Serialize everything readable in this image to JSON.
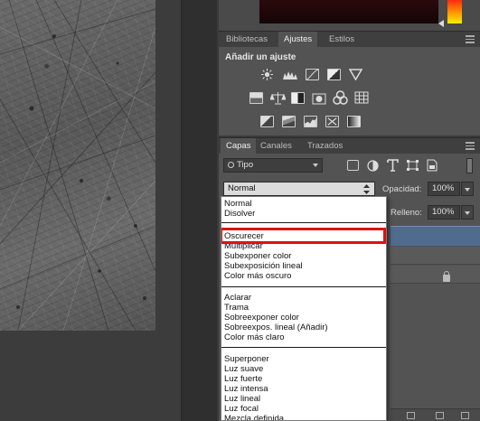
{
  "panels": {
    "adjust_tabs": [
      {
        "label": "Bibliotecas"
      },
      {
        "label": "Ajustes"
      },
      {
        "label": "Estilos"
      }
    ],
    "adjust_title": "Añadir un ajuste",
    "layer_tabs": [
      {
        "label": "Capas"
      },
      {
        "label": "Canales"
      },
      {
        "label": "Trazados"
      }
    ]
  },
  "layers": {
    "filter_value": "Tipo",
    "blend_mode": "Normal",
    "opacity_label": "Opacidad:",
    "opacity_value": "100%",
    "fill_label": "Relleno:",
    "fill_value": "100%"
  },
  "blend_menu": {
    "groups": [
      [
        "Normal",
        "Disolver"
      ],
      [
        "Oscurecer",
        "Multiplicar",
        "Subexponer color",
        "Subexposición lineal",
        "Color más oscuro"
      ],
      [
        "Aclarar",
        "Trama",
        "Sobreexponer color",
        "Sobreexpos. lineal (Añadir)",
        "Color más claro"
      ],
      [
        "Superponer",
        "Luz suave",
        "Luz fuerte",
        "Luz intensa",
        "Luz lineal",
        "Luz focal",
        "Mezcla definida"
      ]
    ],
    "highlighted": "Oscurecer"
  },
  "colors": {
    "accent_highlight": "#e01010",
    "panel_bg": "#535353",
    "selected_layer": "#4f6b8e"
  },
  "icons": {
    "adjustments": [
      "brightness-icon",
      "levels-icon",
      "curves-icon",
      "exposure-icon",
      "vibrance-icon",
      "hue-saturation-icon",
      "color-balance-icon",
      "black-white-icon",
      "photo-filter-icon",
      "channel-mixer-icon",
      "color-lookup-icon",
      "invert-icon",
      "posterize-icon",
      "threshold-icon",
      "selective-color-icon",
      "gradient-map-icon"
    ],
    "layer_filters": [
      "pixel-filter-icon",
      "adjustment-filter-icon",
      "type-filter-icon",
      "shape-filter-icon",
      "smart-object-filter-icon"
    ]
  }
}
